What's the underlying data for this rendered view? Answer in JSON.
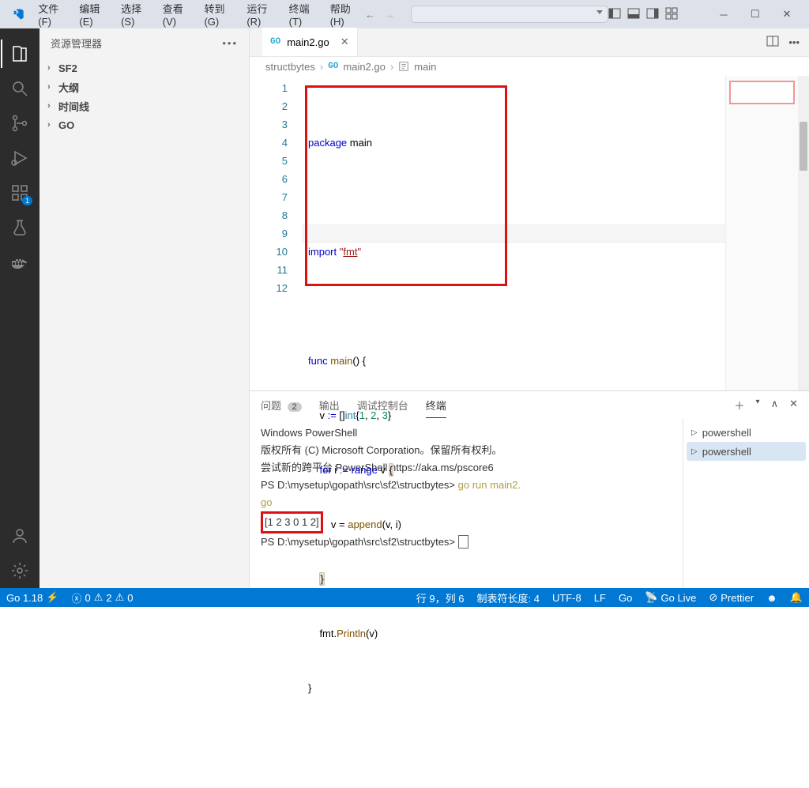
{
  "menu": {
    "items": [
      "文件(F)",
      "编辑(E)",
      "选择(S)",
      "查看(V)",
      "转到(G)",
      "运行(R)",
      "终端(T)",
      "帮助(H)"
    ]
  },
  "sidebar": {
    "title": "资源管理器",
    "items": [
      "SF2",
      "大纲",
      "时间线",
      "GO"
    ]
  },
  "tab": {
    "file": "main2.go"
  },
  "breadcrumb": {
    "folder": "structbytes",
    "file": "main2.go",
    "symbol": "main"
  },
  "code": {
    "lines": [
      "1",
      "2",
      "3",
      "4",
      "5",
      "6",
      "7",
      "8",
      "9",
      "10",
      "11",
      "12"
    ],
    "l1_a": "package",
    "l1_b": " main",
    "l3_a": "import",
    "l3_b": " ",
    "l3_c": "\"",
    "l3_d": "fmt",
    "l3_e": "\"",
    "l5_a": "func",
    "l5_b": " ",
    "l5_c": "main",
    "l5_d": "() {",
    "l6_a": "    v ",
    "l6_b": ":=",
    "l6_c": " []",
    "l6_d": "int",
    "l6_e": "{",
    "l6_f": "1",
    "l6_g": ", ",
    "l6_h": "2",
    "l6_i": ", ",
    "l6_j": "3",
    "l6_k": "}",
    "l7_a": "    ",
    "l7_b": "for",
    "l7_c": " i ",
    "l7_d": ":=",
    "l7_e": " ",
    "l7_f": "range",
    "l7_g": " v ",
    "l7_h": "{",
    "l8_a": "        v = ",
    "l8_b": "append",
    "l8_c": "(v, i)",
    "l9_a": "    ",
    "l9_b": "}",
    "l10_a": "    fmt.",
    "l10_b": "Println",
    "l10_c": "(v)",
    "l11_a": "}"
  },
  "panel": {
    "tabs": {
      "problems": "问题",
      "problems_count": "2",
      "output": "输出",
      "debug": "调试控制台",
      "terminal": "终端"
    },
    "shells": [
      "powershell",
      "powershell"
    ]
  },
  "terminal": {
    "l1": "Windows PowerShell",
    "l2": "版权所有 (C) Microsoft Corporation。保留所有权利。",
    "l3": "",
    "l4": "尝试新的跨平台 PowerShell https://aka.ms/pscore6",
    "l5": "",
    "l6_a": "PS D:\\mysetup\\gopath\\src\\sf2\\structbytes> ",
    "l6_b": "go run main2.",
    "l6_c": "go",
    "l7": "[1 2 3 0 1 2]",
    "l8_a": "PS D:\\mysetup\\gopath\\src\\sf2\\structbytes> "
  },
  "status": {
    "go_ver": "Go 1.18",
    "errs": "0",
    "warns": "2",
    "warn2": "0",
    "cursor": "行 9，列 6",
    "tab": "制表符长度: 4",
    "enc": "UTF-8",
    "eol": "LF",
    "lang": "Go",
    "live": "Go Live",
    "prettier": "Prettier"
  }
}
